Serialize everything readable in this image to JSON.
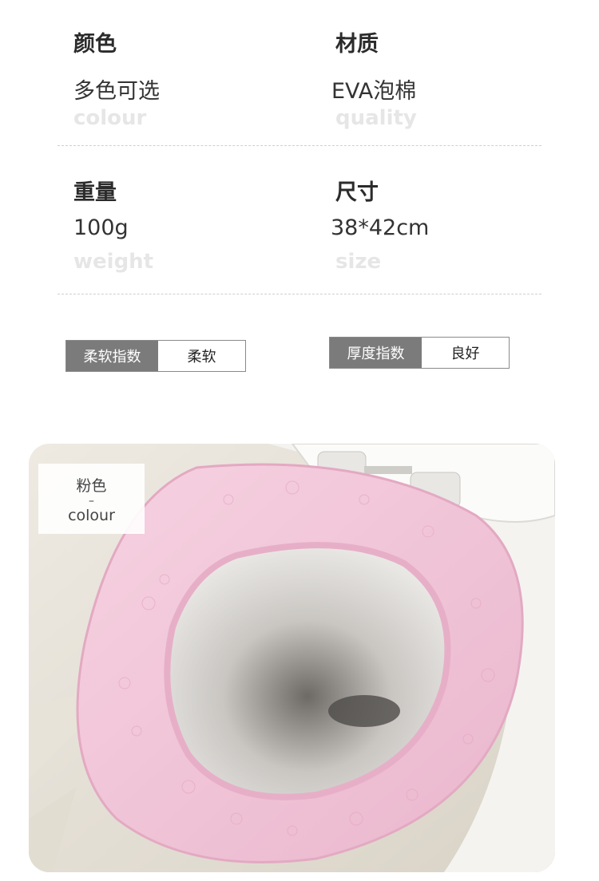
{
  "specs": {
    "colour": {
      "label": "颜色",
      "value": "多色可选",
      "en": "colour"
    },
    "quality": {
      "label": "材质",
      "value": "EVA泡棉",
      "en": "quality"
    },
    "weight": {
      "label": "重量",
      "value": "100g",
      "en": "weight"
    },
    "size": {
      "label": "尺寸",
      "value": "38*42cm",
      "en": "size"
    }
  },
  "indices": {
    "softness": {
      "tag": "柔软指数",
      "value": "柔软"
    },
    "thickness": {
      "tag": "厚度指数",
      "value": "良好"
    }
  },
  "photo": {
    "color_tag_cn": "粉色",
    "color_tag_dash": "–",
    "color_tag_en": "colour",
    "seat_color": "#f2c4d8"
  }
}
